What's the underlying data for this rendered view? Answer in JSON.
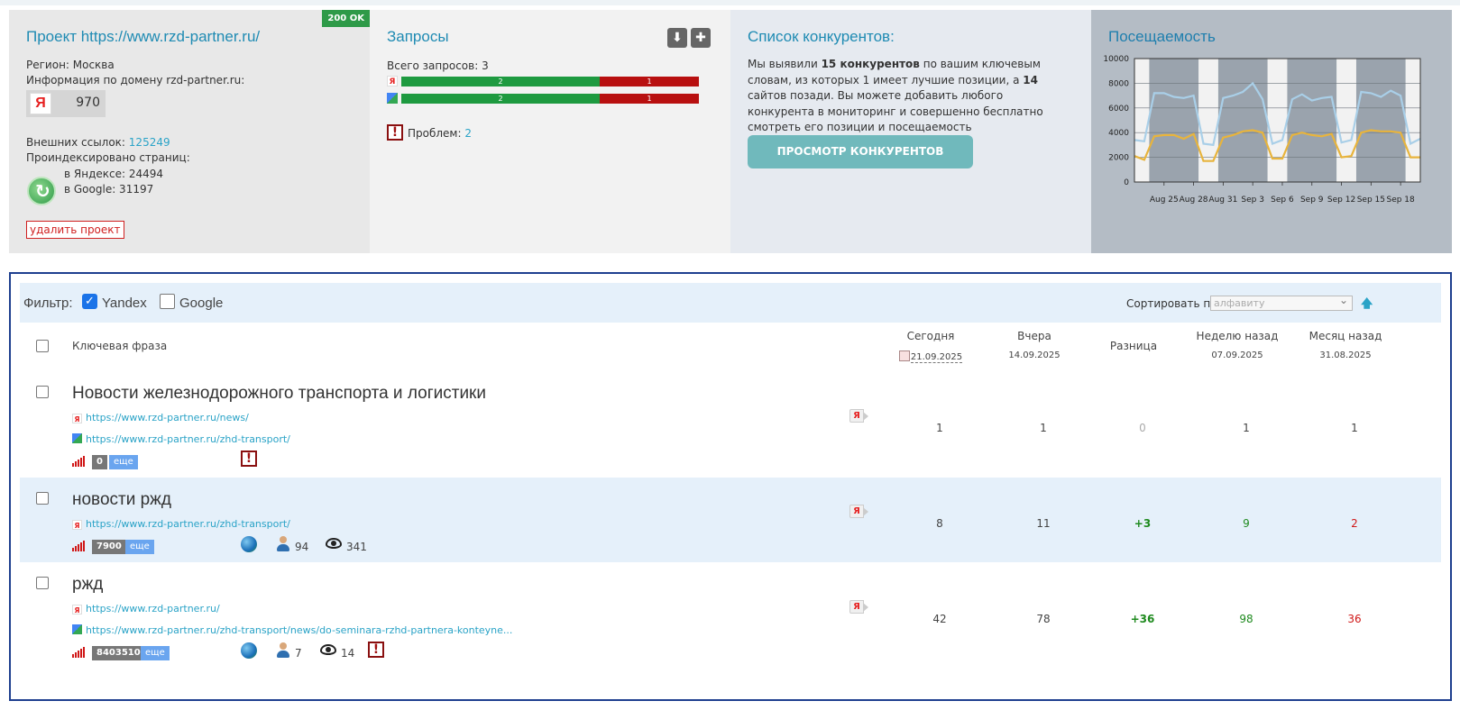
{
  "project": {
    "title": "Проект https://www.rzd-partner.ru/",
    "status_badge": "200 OK",
    "region": "Регион: Москва",
    "domain_info": "Информация по домену rzd-partner.ru:",
    "yandex_logo": "Я",
    "yandex_value": "970",
    "external_links_label": "Внешних ссылок: ",
    "external_links_value": "125249",
    "indexed_label": "Проиндексировано страниц:",
    "indexed_yandex": "в Яндексе: 24494",
    "indexed_google": "в Google: 31197",
    "delete_button": "удалить проект"
  },
  "queries": {
    "title": "Запросы",
    "total": "Всего запросов: 3",
    "bars": [
      {
        "engine": "yandex",
        "green": 2,
        "red": 1,
        "green_label": "2",
        "red_label": "1"
      },
      {
        "engine": "google",
        "green": 2,
        "red": 1,
        "green_label": "2",
        "red_label": "1"
      }
    ],
    "problems_label": "Проблем: ",
    "problems_value": "2"
  },
  "competitors": {
    "title": "Список конкурентов:",
    "text_1": "Мы выявили ",
    "text_bold_1": "15 конкурентов",
    "text_2": " по вашим ключевым словам, из которых 1 имеет лучшие позиции, а ",
    "text_bold_2": "14",
    "text_3": " сайтов позади. Вы можете добавить любого конкурента в мониторинг и совершенно бесплатно смотреть его позиции и посещаемость",
    "button": "ПРОСМОТР КОНКУРЕНТОВ"
  },
  "traffic": {
    "title": "Посещаемость"
  },
  "chart_data": {
    "type": "line",
    "title": "Посещаемость",
    "ylim": [
      0,
      10000
    ],
    "y_ticks": [
      "0",
      "2000",
      "4000",
      "6000",
      "8000",
      "10000"
    ],
    "x_tick_labels": [
      "Aug 25",
      "Aug 28",
      "Aug 31",
      "Sep 3",
      "Sep 6",
      "Sep 9",
      "Sep 12",
      "Sep 15",
      "Sep 18"
    ],
    "x_tick_days": [
      3,
      6,
      9,
      12,
      15,
      18,
      21,
      24,
      27
    ],
    "grid": true,
    "day_count": 30,
    "series": [
      {
        "color": "#a9cfe8",
        "values": [
          3400,
          3300,
          7200,
          7200,
          6900,
          6800,
          7000,
          3100,
          3000,
          6800,
          7000,
          7300,
          8000,
          6700,
          3100,
          3400,
          6700,
          7100,
          6600,
          6800,
          6900,
          3200,
          3400,
          7300,
          7200,
          6900,
          7400,
          7000,
          3100,
          3500
        ]
      },
      {
        "color": "#e8b43c",
        "values": [
          2100,
          1800,
          3700,
          3800,
          3800,
          3500,
          3900,
          1700,
          1700,
          3600,
          3800,
          4100,
          4200,
          4000,
          1900,
          1900,
          3800,
          4000,
          3800,
          3700,
          3900,
          2000,
          2100,
          4000,
          4200,
          4100,
          4100,
          4000,
          2000,
          2000
        ]
      }
    ]
  },
  "filter": {
    "label": "Фильтр:",
    "yandex": "Yandex",
    "google": "Google",
    "sort_label": "Сортировать по:",
    "sort_value": "алфавиту"
  },
  "columns": {
    "keyword": "Ключевая фраза",
    "today": "Сегодня",
    "today_date": "21.09.2025",
    "yesterday": "Вчера",
    "yesterday_date": "14.09.2025",
    "diff": "Разница",
    "week_ago": "Неделю назад",
    "week_date": "07.09.2025",
    "month_ago": "Месяц назад",
    "month_date": "31.08.2025"
  },
  "rows": [
    {
      "keyword": "Новости железнодорожного транспорта и логистики",
      "link_yandex": "https://www.rzd-partner.ru/news/",
      "link_google": "https://www.rzd-partner.ru/zhd-transport/",
      "badge": "0",
      "more": "еще",
      "engine_badge": "Я",
      "today": "1",
      "yesterday": "1",
      "diff": "0",
      "week": "1",
      "month": "1"
    },
    {
      "keyword": "новости ржд",
      "link_yandex": "https://www.rzd-partner.ru/zhd-transport/",
      "badge": "7900",
      "more": "еще",
      "users": "94",
      "views": "341",
      "engine_badge": "Я",
      "today": "8",
      "yesterday": "11",
      "diff": "+3",
      "week": "9",
      "month": "2"
    },
    {
      "keyword": "ржд",
      "link_yandex": "https://www.rzd-partner.ru/",
      "link_google": "https://www.rzd-partner.ru/zhd-transport/news/do-seminara-rzhd-partnera-konteyne...",
      "badge": "8403510",
      "more": "еще",
      "users": "7",
      "views": "14",
      "engine_badge": "Я",
      "today": "42",
      "yesterday": "78",
      "diff": "+36",
      "week": "98",
      "month": "36"
    }
  ]
}
